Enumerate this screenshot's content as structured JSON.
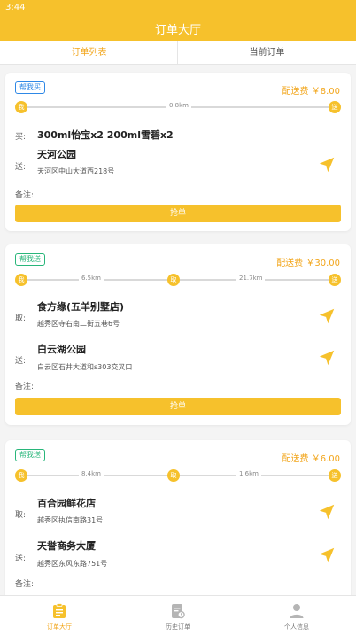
{
  "status_bar": {
    "time": "3:44"
  },
  "header": {
    "title": "订单大厅"
  },
  "tabs": [
    {
      "label": "订单列表",
      "active": true
    },
    {
      "label": "当前订单",
      "active": false
    }
  ],
  "orders": [
    {
      "tag": "帮我买",
      "tag_color": "#2e88e6",
      "fee": "配送费 ￥8.00",
      "route_nodes": [
        "我",
        "送"
      ],
      "distances": [
        "0.8km"
      ],
      "buy_label": "买:",
      "buy_items": "300ml怡宝x2 200ml雪碧x2",
      "deliver_label": "送:",
      "deliver_name": "天河公园",
      "deliver_address": "天河区中山大道西218号",
      "note_label": "备注:",
      "grab_label": "抢单"
    },
    {
      "tag": "帮我送",
      "tag_color": "#28b67a",
      "fee": "配送费 ￥30.00",
      "route_nodes": [
        "我",
        "取",
        "送"
      ],
      "distances": [
        "6.5km",
        "21.7km"
      ],
      "pickup_label": "取:",
      "pickup_name": "食方缘(五羊别墅店)",
      "pickup_address": "越秀区寺右南二街五巷6号",
      "deliver_label": "送:",
      "deliver_name": "白云湖公园",
      "deliver_address": "白云区石井大道和s303交叉口",
      "note_label": "备注:",
      "grab_label": "抢单"
    },
    {
      "tag": "帮我送",
      "tag_color": "#28b67a",
      "fee": "配送费 ￥6.00",
      "route_nodes": [
        "我",
        "取",
        "送"
      ],
      "distances": [
        "8.4km",
        "1.6km"
      ],
      "pickup_label": "取:",
      "pickup_name": "百合园鲜花店",
      "pickup_address": "越秀区执信南路31号",
      "deliver_label": "送:",
      "deliver_name": "天誉商务大厦",
      "deliver_address": "越秀区东风东路751号",
      "note_label": "备注:"
    }
  ],
  "bottom_nav": [
    {
      "label": "订单大厅",
      "icon": "clipboard-icon",
      "active": true
    },
    {
      "label": "历史订单",
      "icon": "history-document-icon",
      "active": false
    },
    {
      "label": "个人信息",
      "icon": "person-icon",
      "active": false
    }
  ],
  "colors": {
    "accent": "#f6c12c",
    "accent_text": "#f2a51a",
    "tag_blue": "#2e88e6",
    "tag_green": "#28b67a"
  }
}
